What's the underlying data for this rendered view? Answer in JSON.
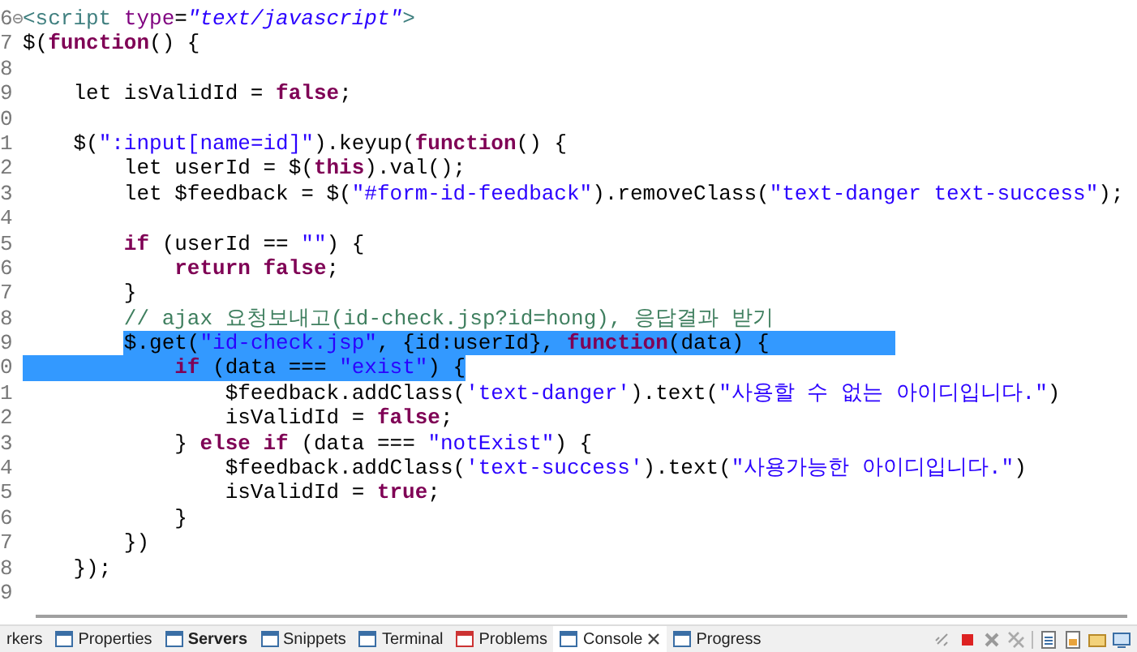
{
  "editor": {
    "lines": [
      {
        "number": "6",
        "fold": true,
        "tokens": [
          {
            "kind": "tag",
            "text": "<script "
          },
          {
            "kind": "attr",
            "text": "type"
          },
          {
            "kind": "plain",
            "text": "="
          },
          {
            "kind": "value",
            "text": "\"text/javascript\""
          },
          {
            "kind": "tag",
            "text": ">"
          }
        ]
      },
      {
        "number": "7",
        "tokens": [
          {
            "kind": "plain",
            "text": "$("
          },
          {
            "kind": "keyword",
            "text": "function"
          },
          {
            "kind": "plain",
            "text": "() {"
          }
        ]
      },
      {
        "number": "8"
      },
      {
        "number": "9",
        "tokens": [
          {
            "kind": "plain",
            "text": "    let isValidId = "
          },
          {
            "kind": "keyword",
            "text": "false"
          },
          {
            "kind": "plain",
            "text": ";"
          }
        ]
      },
      {
        "number": "0"
      },
      {
        "number": "1",
        "tokens": [
          {
            "kind": "plain",
            "text": "    $("
          },
          {
            "kind": "string",
            "text": "\":input[name=id]\""
          },
          {
            "kind": "plain",
            "text": ").keyup("
          },
          {
            "kind": "keyword",
            "text": "function"
          },
          {
            "kind": "plain",
            "text": "() {"
          }
        ]
      },
      {
        "number": "2",
        "tokens": [
          {
            "kind": "plain",
            "text": "        let userId = $("
          },
          {
            "kind": "keyword",
            "text": "this"
          },
          {
            "kind": "plain",
            "text": ").val();"
          }
        ]
      },
      {
        "number": "3",
        "tokens": [
          {
            "kind": "plain",
            "text": "        let $feedback = $("
          },
          {
            "kind": "string",
            "text": "\"#form-id-feedback\""
          },
          {
            "kind": "plain",
            "text": ").removeClass("
          },
          {
            "kind": "string",
            "text": "\"text-danger text-success\""
          },
          {
            "kind": "plain",
            "text": ");"
          }
        ]
      },
      {
        "number": "4"
      },
      {
        "number": "5",
        "tokens": [
          {
            "kind": "keyword",
            "text": "        if"
          },
          {
            "kind": "plain",
            "text": " (userId == "
          },
          {
            "kind": "string",
            "text": "\"\""
          },
          {
            "kind": "plain",
            "text": ") {"
          }
        ]
      },
      {
        "number": "6",
        "tokens": [
          {
            "kind": "keyword",
            "text": "            return"
          },
          {
            "kind": "keyword",
            "text": " false"
          },
          {
            "kind": "plain",
            "text": ";"
          }
        ]
      },
      {
        "number": "7",
        "tokens": [
          {
            "kind": "plain",
            "text": "        }"
          }
        ]
      },
      {
        "number": "8",
        "tokens": [
          {
            "kind": "comment",
            "text": "        // ajax 요청보내고(id-check.jsp?id=hong), 응답결과 받기"
          }
        ]
      },
      {
        "number": "9",
        "selected": true,
        "indent_selected": false,
        "tokens": [
          {
            "kind": "plain",
            "text": "        $.get("
          },
          {
            "kind": "string",
            "text": "\"id-check.jsp\""
          },
          {
            "kind": "plain",
            "text": ", {id:userId}, "
          },
          {
            "kind": "keyword",
            "text": "function"
          },
          {
            "kind": "plain",
            "text": "(data) {"
          }
        ]
      },
      {
        "number": "0",
        "selected": true,
        "indent_selected": true,
        "tokens": [
          {
            "kind": "keyword",
            "text": "            if"
          },
          {
            "kind": "plain",
            "text": " (data === "
          },
          {
            "kind": "string",
            "text": "\"exist\""
          },
          {
            "kind": "plain",
            "text": ") {"
          }
        ]
      },
      {
        "number": "1",
        "tokens": [
          {
            "kind": "plain",
            "text": "                $feedback.addClass("
          },
          {
            "kind": "string",
            "text": "'text-danger'"
          },
          {
            "kind": "plain",
            "text": ").text("
          },
          {
            "kind": "string",
            "text": "\"사용할 수 없는 아이디입니다.\""
          },
          {
            "kind": "plain",
            "text": ")"
          }
        ]
      },
      {
        "number": "2",
        "tokens": [
          {
            "kind": "plain",
            "text": "                isValidId = "
          },
          {
            "kind": "keyword",
            "text": "false"
          },
          {
            "kind": "plain",
            "text": ";"
          }
        ]
      },
      {
        "number": "3",
        "tokens": [
          {
            "kind": "plain",
            "text": "            } "
          },
          {
            "kind": "keyword",
            "text": "else"
          },
          {
            "kind": "keyword",
            "text": " if"
          },
          {
            "kind": "plain",
            "text": " (data === "
          },
          {
            "kind": "string",
            "text": "\"notExist\""
          },
          {
            "kind": "plain",
            "text": ") {"
          }
        ]
      },
      {
        "number": "4",
        "tokens": [
          {
            "kind": "plain",
            "text": "                $feedback.addClass("
          },
          {
            "kind": "string",
            "text": "'text-success'"
          },
          {
            "kind": "plain",
            "text": ").text("
          },
          {
            "kind": "string",
            "text": "\"사용가능한 아이디입니다.\""
          },
          {
            "kind": "plain",
            "text": ")"
          }
        ]
      },
      {
        "number": "5",
        "tokens": [
          {
            "kind": "plain",
            "text": "                isValidId = "
          },
          {
            "kind": "keyword",
            "text": "true"
          },
          {
            "kind": "plain",
            "text": ";"
          }
        ]
      },
      {
        "number": "6",
        "tokens": [
          {
            "kind": "plain",
            "text": "            }"
          }
        ]
      },
      {
        "number": "7",
        "tokens": [
          {
            "kind": "plain",
            "text": "        })"
          }
        ]
      },
      {
        "number": "8",
        "tokens": [
          {
            "kind": "plain",
            "text": "    });"
          }
        ]
      },
      {
        "number": "9"
      }
    ]
  },
  "panel_tabs": [
    {
      "label": "rkers",
      "selected": false,
      "bold": false
    },
    {
      "label": "Properties",
      "selected": false,
      "bold": false
    },
    {
      "label": "Servers",
      "selected": false,
      "bold": true
    },
    {
      "label": "Snippets",
      "selected": false,
      "bold": false
    },
    {
      "label": "Terminal",
      "selected": false,
      "bold": false
    },
    {
      "label": "Problems",
      "selected": false,
      "bold": false
    },
    {
      "label": "Console",
      "selected": true,
      "bold": false
    },
    {
      "label": "Progress",
      "selected": false,
      "bold": false
    }
  ]
}
